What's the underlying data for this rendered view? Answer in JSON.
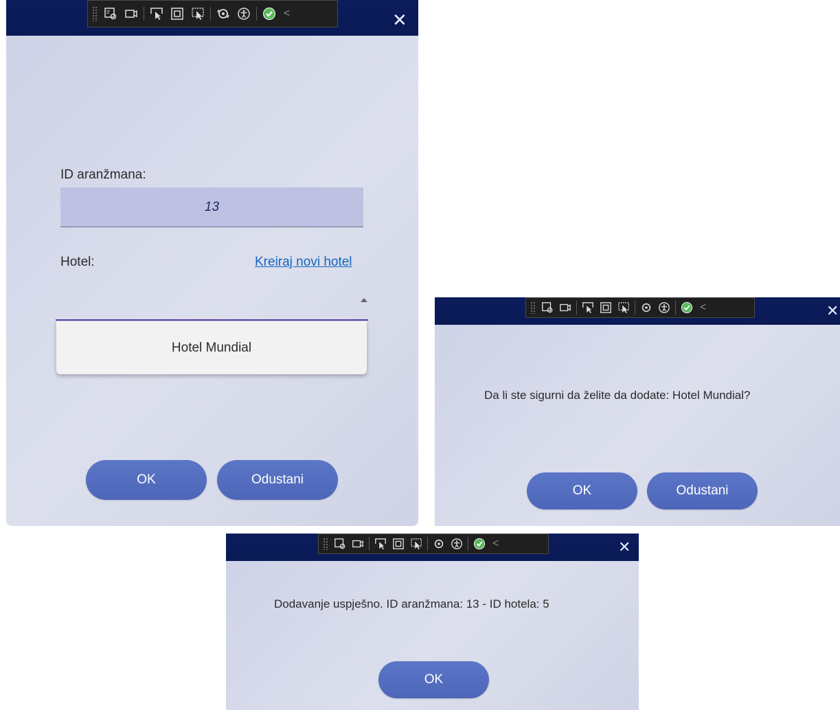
{
  "toolbar": {
    "icons": [
      "select-element-icon",
      "video-icon",
      "pointer-icon",
      "frame-icon",
      "selection-icon",
      "hot-reload-icon",
      "accessibility-icon",
      "check-icon",
      "chevron-left-icon"
    ],
    "collapse": "<"
  },
  "close_glyph": "✕",
  "dialog_main": {
    "id_label": "ID aranžmana:",
    "id_value": "13",
    "hotel_label": "Hotel:",
    "create_hotel_link": "Kreiraj novi hotel",
    "dropdown_items": [
      "Hotel Mundial"
    ],
    "ok_label": "OK",
    "cancel_label": "Odustani"
  },
  "dialog_confirm": {
    "message": "Da li ste sigurni da želite da dodate: Hotel Mundial?",
    "ok_label": "OK",
    "cancel_label": "Odustani"
  },
  "dialog_success": {
    "message": "Dodavanje uspješno. ID aranžmana: 13 - ID hotela: 5",
    "ok_label": "OK"
  },
  "colors": {
    "titlebar": "#0c1c5c",
    "button": "#5470c0",
    "link": "#1565c0",
    "input_bg": "#bfc1e2",
    "combo_underline": "#5a3ea8"
  }
}
